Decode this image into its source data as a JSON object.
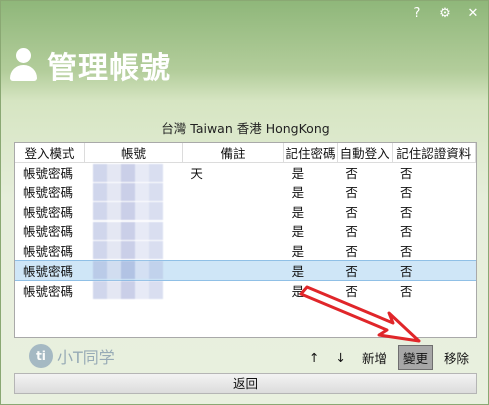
{
  "window": {
    "controls": [
      "?",
      "⚙",
      "✕"
    ]
  },
  "header": {
    "title": "管理帳號"
  },
  "regions": "台灣 Taiwan 香港 HongKong",
  "table": {
    "headers": [
      "登入模式",
      "帳號",
      "備註",
      "記住密碼",
      "自動登入",
      "記住認證資料"
    ],
    "rows": [
      [
        "帳號密碼",
        "",
        "天",
        "是",
        "否",
        "否"
      ],
      [
        "帳號密碼",
        "",
        "",
        "是",
        "否",
        "否"
      ],
      [
        "帳號密碼",
        "",
        "",
        "是",
        "否",
        "否"
      ],
      [
        "帳號密碼",
        "",
        "",
        "是",
        "否",
        "否"
      ],
      [
        "帳號密碼",
        "",
        "",
        "是",
        "否",
        "否"
      ],
      [
        "帳號密碼",
        "",
        "",
        "是",
        "否",
        "否"
      ],
      [
        "帳號密碼",
        "",
        "",
        "是",
        "否",
        "否"
      ]
    ]
  },
  "toolbar": {
    "up": "↑",
    "down": "↓",
    "add": "新增",
    "edit": "變更",
    "remove": "移除"
  },
  "watermark": {
    "logo": "ti",
    "text": "小T同学"
  },
  "back_label": "返回",
  "colors": {
    "header_green": "#8fb77a",
    "selected_row": "#cfe6f7",
    "arrow_red": "#e0262a"
  }
}
